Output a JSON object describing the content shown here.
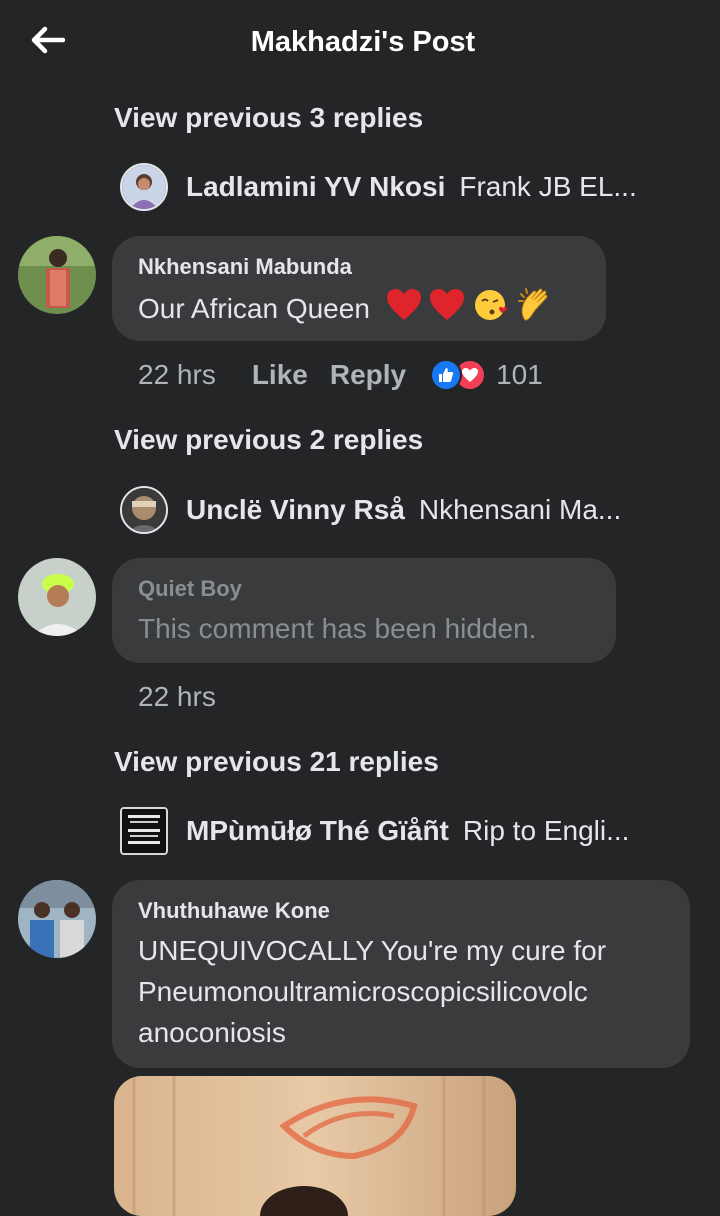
{
  "header": {
    "title": "Makhadzi's Post"
  },
  "threads": [
    {
      "view_previous": "View previous 3 replies",
      "preview": {
        "name": "Ladlamini YV Nkosi",
        "text": "Frank JB EL..."
      },
      "comment": {
        "author": "Nkhensani Mabunda",
        "text": "Our African  Queen",
        "emojis": [
          "red-heart",
          "red-heart",
          "face-blowing-kiss",
          "clapping-hands"
        ],
        "time": "22 hrs",
        "like_label": "Like",
        "reply_label": "Reply",
        "reactions": [
          "like-icon",
          "love-icon"
        ],
        "reaction_count": "101"
      }
    },
    {
      "view_previous": "View previous 2 replies",
      "preview": {
        "name": "Unclë Vinny Rså",
        "text": "Nkhensani Ma..."
      },
      "comment": {
        "author": "Quiet Boy",
        "text": "This comment has been hidden.",
        "time": "22 hrs"
      }
    },
    {
      "view_previous": "View previous 21 replies",
      "preview": {
        "name": "MPùmūłø Thé Gïåñt",
        "text": "Rip to Engli..."
      },
      "comment": {
        "author": "Vhuthuhawe Kone",
        "text_lines": [
          "UNEQUIVOCALLY You're my cure for",
          "Pneumonoultramicroscopicsilicovolc",
          "anoconiosis"
        ]
      }
    }
  ],
  "colors": {
    "background": "#242526",
    "bubble": "#3a3b3c",
    "text": "#e4e6eb",
    "secondary_text": "#b0b3b8",
    "like_blue": "#1877f2",
    "love_red": "#f33e58"
  }
}
